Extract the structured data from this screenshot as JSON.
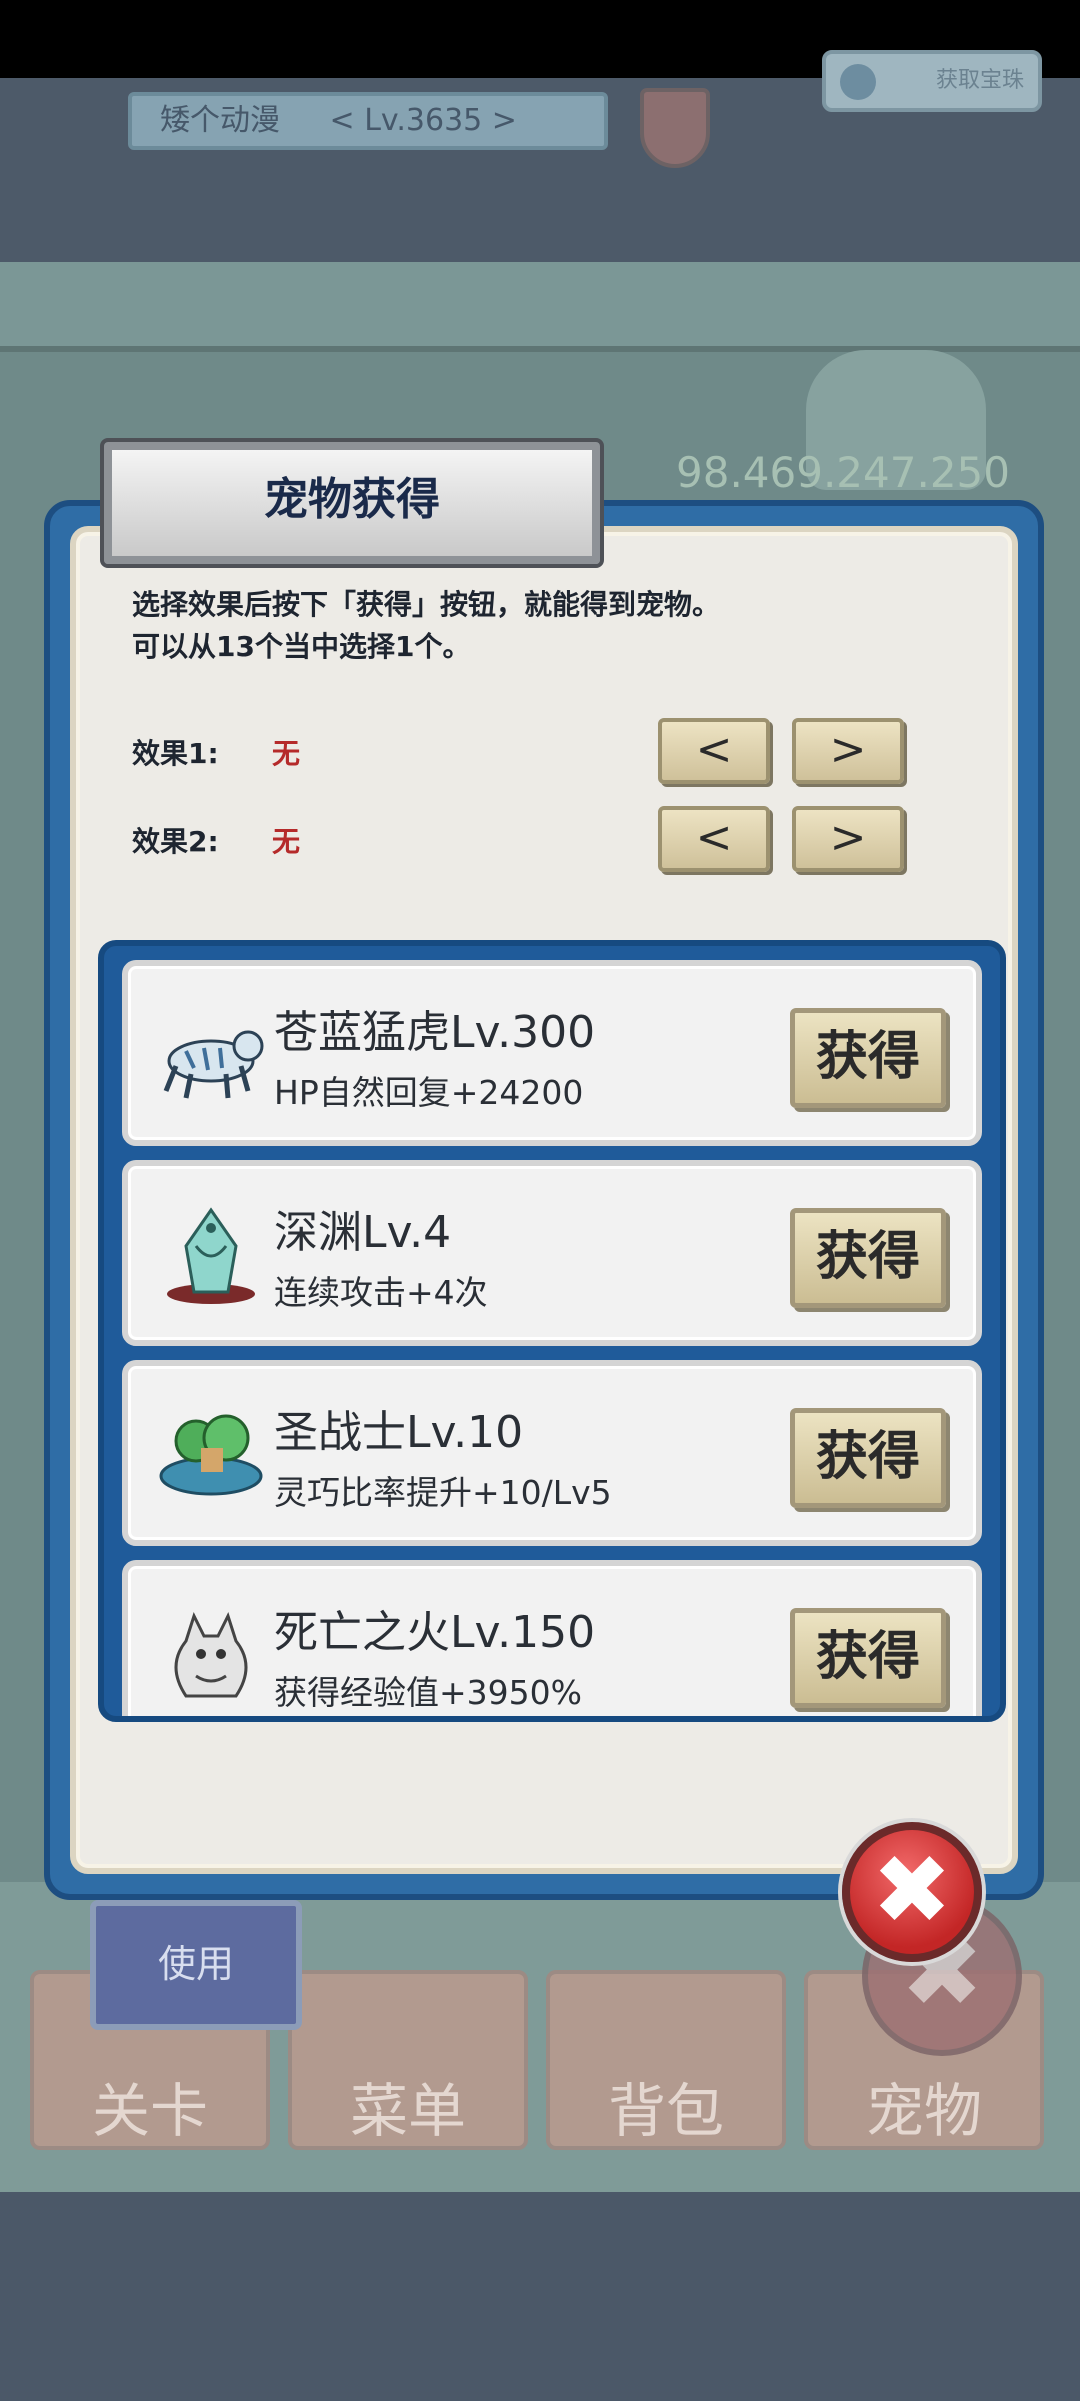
{
  "background": {
    "player_name": "矮个动漫",
    "player_level": "< Lv.3635 >",
    "gem_button_label": "获取宝珠",
    "gold_amount": "98.469.247.250",
    "use_button": "使用",
    "tabs": [
      "关卡",
      "菜单",
      "背包",
      "宠物"
    ]
  },
  "dialog": {
    "title": "宠物获得",
    "description_line1": "选择效果后按下「获得」按钮，就能得到宠物。",
    "description_line2": "可以从13个当中选择1个。",
    "effect1_label": "效果1:",
    "effect1_value": "无",
    "effect2_label": "效果2:",
    "effect2_value": "无",
    "prev_label": "<",
    "next_label": ">",
    "get_label": "获得",
    "pets": [
      {
        "name": "苍蓝猛虎Lv.300",
        "effect": "HP自然回复+24200",
        "icon": "blue-tiger-icon"
      },
      {
        "name": "深渊Lv.4",
        "effect": "连续攻击+4次",
        "icon": "abyss-dragon-icon"
      },
      {
        "name": "圣战士Lv.10",
        "effect": "灵巧比率提升+10/Lv5",
        "icon": "holy-warrior-icon"
      },
      {
        "name": "死亡之火Lv.150",
        "effect": "获得经验值+3950%",
        "icon": "death-fire-icon"
      }
    ],
    "close_symbol": "✖"
  },
  "colors": {
    "dialog_frame": "#2f6da6",
    "effect_value": "#b52a2a",
    "close_button": "#c32626"
  }
}
